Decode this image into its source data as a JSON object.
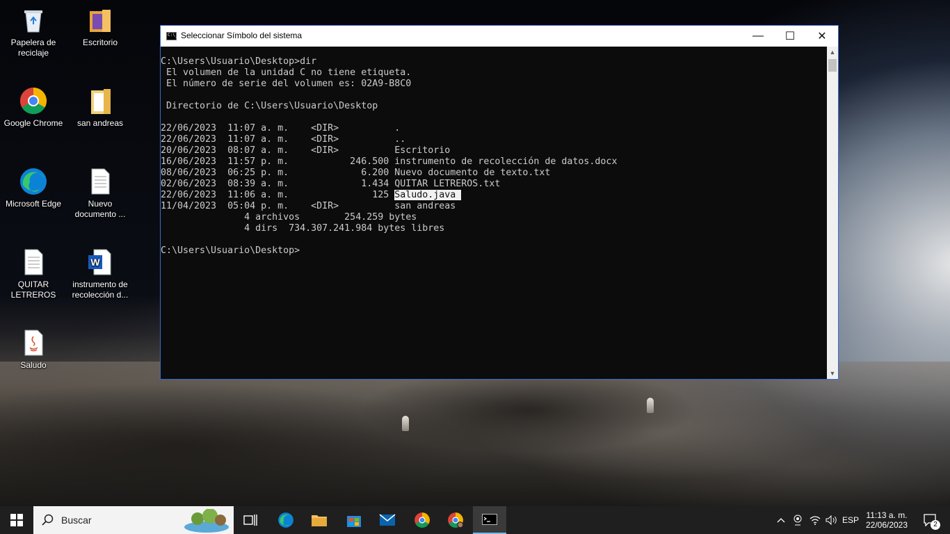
{
  "desktop": {
    "icons": [
      {
        "label": "Papelera de reciclaje"
      },
      {
        "label": "Escritorio"
      },
      {
        "label": "Google Chrome"
      },
      {
        "label": "san andreas"
      },
      {
        "label": "Microsoft Edge"
      },
      {
        "label": "Nuevo documento ..."
      },
      {
        "label": "QUITAR LETREROS"
      },
      {
        "label": "instrumento de recolección d..."
      },
      {
        "label": "Saludo"
      }
    ]
  },
  "window": {
    "title": "Seleccionar Símbolo del sistema",
    "minimize": "—",
    "maximize": "☐",
    "close": "✕",
    "lines": [
      "C:\\Users\\Usuario\\Desktop>dir",
      " El volumen de la unidad C no tiene etiqueta.",
      " El número de serie del volumen es: 02A9-B8C0",
      "",
      " Directorio de C:\\Users\\Usuario\\Desktop",
      "",
      "22/06/2023  11:07 a. m.    <DIR>          .",
      "22/06/2023  11:07 a. m.    <DIR>          ..",
      "20/06/2023  08:07 a. m.    <DIR>          Escritorio",
      "16/06/2023  11:57 p. m.           246.500 instrumento de recolección de datos.docx",
      "08/06/2023  06:25 p. m.             6.200 Nuevo documento de texto.txt",
      "02/06/2023  08:39 a. m.             1.434 QUITAR LETREROS.txt",
      "",
      "11/04/2023  05:04 p. m.    <DIR>          san andreas",
      "               4 archivos        254.259 bytes",
      "               4 dirs  734.307.241.984 bytes libres",
      "",
      "C:\\Users\\Usuario\\Desktop>"
    ],
    "selected_line_prefix": "22/06/2023  11:06 a. m.               125 ",
    "selected_text": "Saludo.java "
  },
  "taskbar": {
    "search_label": "Buscar",
    "language": "ESP",
    "time": "11:13 a. m.",
    "date": "22/06/2023",
    "notification_count": "2"
  },
  "colors": {
    "console_bg": "#0c0c0c",
    "console_fg": "#cccccc",
    "taskbar_bg": "#1f1f1f",
    "accent": "#0078d4"
  }
}
